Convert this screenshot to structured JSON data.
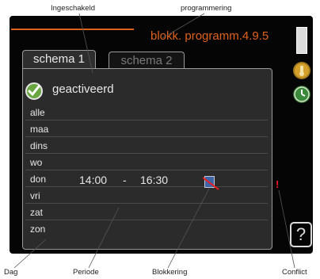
{
  "callouts": {
    "ingeschakeld": "Ingeschakeld",
    "programmering": "programmering",
    "dag": "Dag",
    "periode": "Periode",
    "blokkering": "Blokkering",
    "conflict": "Conflict"
  },
  "screen": {
    "menu_title": "blokk. programm.4.9.5",
    "tabs": [
      {
        "label": "schema 1",
        "selected": true
      },
      {
        "label": "schema 2",
        "selected": false
      }
    ],
    "activated_label": "geactiveerd",
    "days": [
      "alle",
      "maa",
      "dins",
      "wo",
      "don",
      "vri",
      "zat",
      "zon"
    ],
    "don_row": {
      "start": "14:00",
      "separator": "-",
      "end": "16:30"
    },
    "conflict_mark": "!",
    "help_label": "?"
  },
  "colors": {
    "accent": "#e0621b",
    "checkmark_green": "#6aa640",
    "block_blue": "#3d63a8",
    "conflict_red": "#ee1c1c"
  },
  "icons": [
    "check-icon",
    "block-icon",
    "thermometer-icon",
    "clock-icon",
    "help-icon"
  ]
}
